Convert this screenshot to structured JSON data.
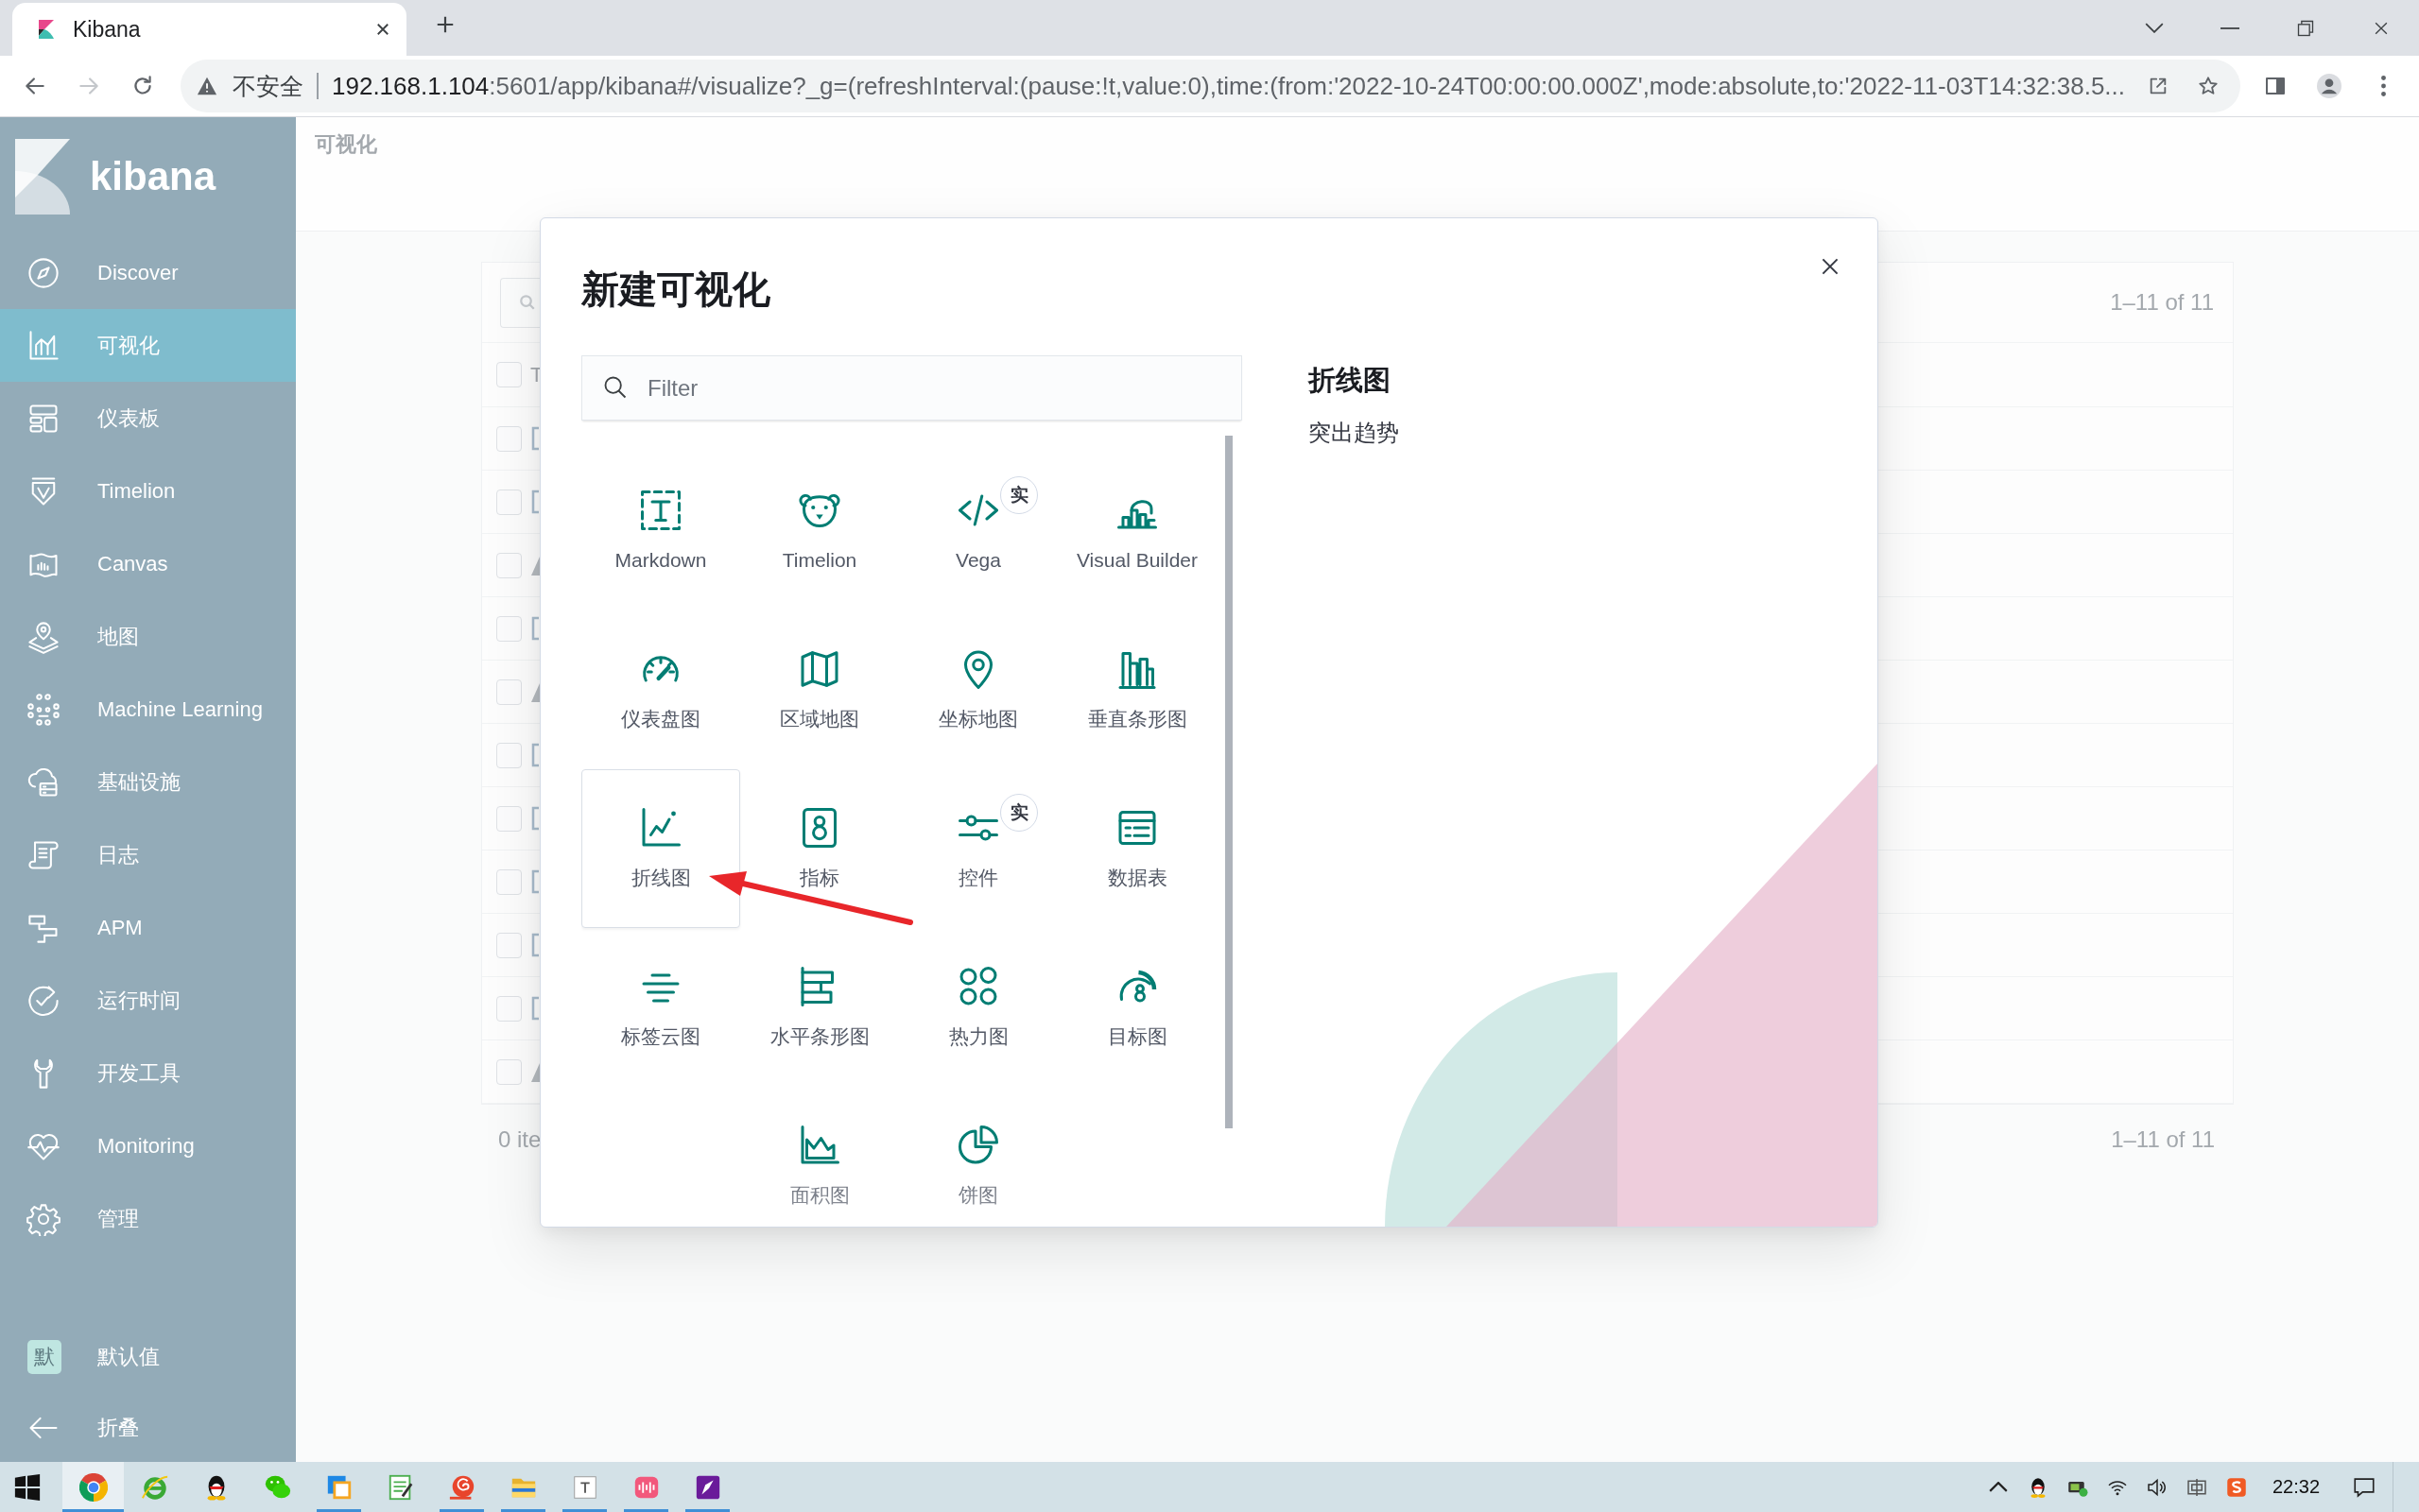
{
  "browser": {
    "tab": {
      "title": "Kibana",
      "selected": true
    },
    "nav_buttons": [
      {
        "kind": "back",
        "disabled": false
      },
      {
        "kind": "forward",
        "disabled": true
      },
      {
        "kind": "reload",
        "disabled": false
      }
    ],
    "address": {
      "security_label": "不安全",
      "host": "192.168.1.104",
      "path": ":5601/app/kibana#/visualize?_g=(refreshInterval:(pause:!t,value:0),time:(from:'2022-10-24T00:00:00.000Z',mode:absolute,to:'2022-11-03T14:32:38.5..."
    }
  },
  "sidebar": {
    "brand": "kibana",
    "items": [
      {
        "label": "Discover",
        "kind": "compass",
        "selected": false
      },
      {
        "label": "可视化",
        "kind": "visualize",
        "selected": true
      },
      {
        "label": "仪表板",
        "kind": "dashboard",
        "selected": false
      },
      {
        "label": "Timelion",
        "kind": "timelion",
        "selected": false
      },
      {
        "label": "Canvas",
        "kind": "canvas",
        "selected": false
      },
      {
        "label": "地图",
        "kind": "maps",
        "selected": false
      },
      {
        "label": "Machine Learning",
        "kind": "ml",
        "selected": false
      },
      {
        "label": "基础设施",
        "kind": "infra",
        "selected": false
      },
      {
        "label": "日志",
        "kind": "logs",
        "selected": false
      },
      {
        "label": "APM",
        "kind": "apm",
        "selected": false
      },
      {
        "label": "运行时间",
        "kind": "uptime",
        "selected": false
      },
      {
        "label": "开发工具",
        "kind": "devtools",
        "selected": false
      },
      {
        "label": "Monitoring",
        "kind": "monitoring",
        "selected": false
      },
      {
        "label": "管理",
        "kind": "management",
        "selected": false
      }
    ],
    "user": {
      "initial": "默",
      "label": "默认值"
    },
    "collapse_label": "折叠"
  },
  "page": {
    "breadcrumb": "可视化",
    "table": {
      "count_top": "1–11 of 11",
      "column_1": "T",
      "header_checked": false,
      "rows": [
        {
          "kind": "chart",
          "checked": false
        },
        {
          "kind": "chart",
          "checked": false
        },
        {
          "kind": "lab",
          "checked": false
        },
        {
          "kind": "chart",
          "checked": false
        },
        {
          "kind": "lab",
          "checked": false
        },
        {
          "kind": "chart",
          "checked": false
        },
        {
          "kind": "chart",
          "checked": false
        },
        {
          "kind": "chart",
          "checked": false
        },
        {
          "kind": "chart",
          "checked": false
        },
        {
          "kind": "chart",
          "checked": false
        },
        {
          "kind": "lab",
          "checked": false
        }
      ],
      "selection_text": "0 ite",
      "count_bottom": "1–11 of 11"
    }
  },
  "modal": {
    "title": "新建可视化",
    "filter": {
      "placeholder": "Filter"
    },
    "types": [
      {
        "label": "Markdown",
        "kind": "markdown",
        "selected": false
      },
      {
        "label": "Timelion",
        "kind": "timelion",
        "selected": false
      },
      {
        "label": "Vega",
        "kind": "vega",
        "selected": false,
        "badge": "实"
      },
      {
        "label": "Visual Builder",
        "kind": "builder",
        "selected": false
      },
      {
        "label": "仪表盘图",
        "kind": "gauge",
        "selected": false
      },
      {
        "label": "区域地图",
        "kind": "regionmap",
        "selected": false
      },
      {
        "label": "坐标地图",
        "kind": "coordmap",
        "selected": false
      },
      {
        "label": "垂直条形图",
        "kind": "verticalbar",
        "selected": false
      },
      {
        "label": "折线图",
        "kind": "line",
        "selected": true
      },
      {
        "label": "指标",
        "kind": "metric",
        "selected": false
      },
      {
        "label": "控件",
        "kind": "controls",
        "selected": false,
        "badge": "实"
      },
      {
        "label": "数据表",
        "kind": "table",
        "selected": false
      },
      {
        "label": "标签云图",
        "kind": "tagcloud",
        "selected": false
      },
      {
        "label": "水平条形图",
        "kind": "horizontalbar",
        "selected": false
      },
      {
        "label": "热力图",
        "kind": "heatmap",
        "selected": false
      },
      {
        "label": "目标图",
        "kind": "goal",
        "selected": false
      },
      {
        "label": "面积图",
        "kind": "area",
        "selected": false
      },
      {
        "label": "饼图",
        "kind": "pie",
        "selected": false
      }
    ],
    "detail": {
      "title": "折线图",
      "description": "突出趋势"
    }
  },
  "taskbar": {
    "apps": [
      {
        "kind": "chrome",
        "selected": true,
        "running": true
      },
      {
        "kind": "ebrowser",
        "selected": false,
        "running": false
      },
      {
        "kind": "penguin",
        "selected": false,
        "running": false
      },
      {
        "kind": "chat",
        "selected": false,
        "running": false
      },
      {
        "kind": "windowapp",
        "selected": false,
        "running": true
      },
      {
        "kind": "notepad",
        "selected": false,
        "running": false
      },
      {
        "kind": "snail",
        "selected": false,
        "running": true
      },
      {
        "kind": "folder",
        "selected": false,
        "running": true
      },
      {
        "kind": "texteditor",
        "selected": false,
        "running": true
      },
      {
        "kind": "audio",
        "selected": false,
        "running": true
      },
      {
        "kind": "pen",
        "selected": false,
        "running": true
      }
    ],
    "tray": [
      {
        "kind": "chevron"
      },
      {
        "kind": "penguin"
      },
      {
        "kind": "battery"
      },
      {
        "kind": "wifi"
      },
      {
        "kind": "speaker"
      },
      {
        "kind": "ime"
      },
      {
        "kind": "imelogo"
      }
    ],
    "clock": "22:32"
  }
}
